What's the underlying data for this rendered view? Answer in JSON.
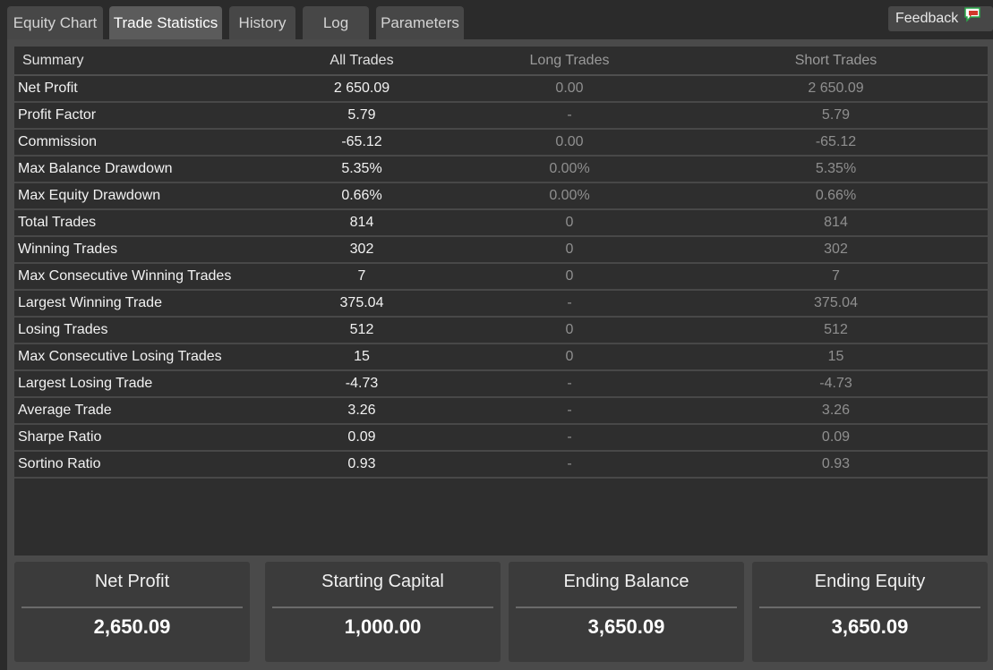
{
  "tabs": {
    "equity_chart": "Equity Chart",
    "trade_statistics": "Trade Statistics",
    "history": "History",
    "log": "Log",
    "parameters": "Parameters"
  },
  "feedback": {
    "label": "Feedback",
    "icon": "speech-bubble-icon"
  },
  "table": {
    "headers": [
      "Summary",
      "All Trades",
      "Long Trades",
      "Short Trades"
    ],
    "rows": [
      [
        "Net Profit",
        "2 650.09",
        "0.00",
        "2 650.09"
      ],
      [
        "Profit Factor",
        "5.79",
        "-",
        "5.79"
      ],
      [
        "Commission",
        "-65.12",
        "0.00",
        "-65.12"
      ],
      [
        "Max Balance Drawdown",
        "5.35%",
        "0.00%",
        "5.35%"
      ],
      [
        "Max Equity Drawdown",
        "0.66%",
        "0.00%",
        "0.66%"
      ],
      [
        "Total Trades",
        "814",
        "0",
        "814"
      ],
      [
        "Winning Trades",
        "302",
        "0",
        "302"
      ],
      [
        "Max Consecutive Winning Trades",
        "7",
        "0",
        "7"
      ],
      [
        "Largest Winning Trade",
        "375.04",
        "-",
        "375.04"
      ],
      [
        "Losing Trades",
        "512",
        "0",
        "512"
      ],
      [
        "Max Consecutive Losing Trades",
        "15",
        "0",
        "15"
      ],
      [
        "Largest Losing Trade",
        "-4.73",
        "-",
        "-4.73"
      ],
      [
        "Average Trade",
        "3.26",
        "-",
        "3.26"
      ],
      [
        "Sharpe Ratio",
        "0.09",
        "-",
        "0.09"
      ],
      [
        "Sortino Ratio",
        "0.93",
        "-",
        "0.93"
      ]
    ]
  },
  "cards": [
    {
      "title": "Net Profit",
      "value": "2,650.09"
    },
    {
      "title": "Starting Capital",
      "value": "1,000.00"
    },
    {
      "title": "Ending Balance",
      "value": "3,650.09"
    },
    {
      "title": "Ending Equity",
      "value": "3,650.09"
    }
  ]
}
